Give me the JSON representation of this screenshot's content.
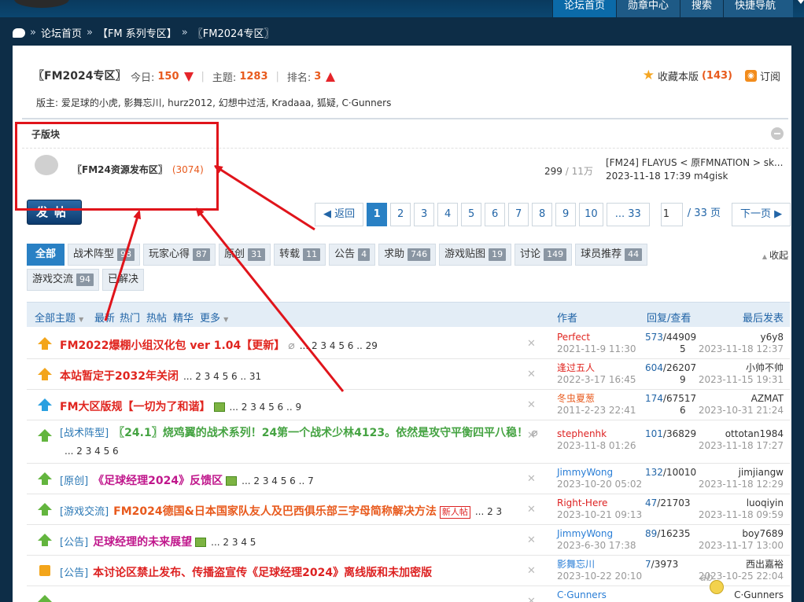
{
  "nav": {
    "items": [
      {
        "label": "论坛首页",
        "active": true
      },
      {
        "label": "勋章中心",
        "active": false
      },
      {
        "label": "搜索",
        "active": false
      },
      {
        "label": "快捷导航",
        "active": false
      }
    ]
  },
  "breadcrumb": {
    "items": [
      "论坛首页",
      "【FM 系列专区】",
      "〖FM2024专区〗"
    ],
    "sep": "»"
  },
  "forum": {
    "title": "〖FM2024专区〗",
    "today_label": "今日:",
    "today": "150",
    "topics_label": "主题:",
    "topics": "1283",
    "rank_label": "排名:",
    "rank": "3",
    "fav_label": "收藏本版",
    "fav_count": "(143)",
    "subscribe_label": "订阅",
    "moderators": "版主: 爱足球的小虎, 影舞忘川, hurz2012, 幻想中过活, Kradaaa, 狐疑, C·Gunners"
  },
  "subforums": {
    "heading": "子版块",
    "items": [
      {
        "name": "〖FM24资源发布区〗",
        "count": "(3074)",
        "stat": "299",
        "stat2": "11万",
        "stat_sep": "/",
        "last_title": "[FM24] FLAYUS < 原FMNATION > sk...",
        "last_info": "2023-11-18 17:39 m4gisk"
      }
    ]
  },
  "post_button": "发帖",
  "pager": {
    "back": "返回",
    "pages": [
      "1",
      "2",
      "3",
      "4",
      "5",
      "6",
      "7",
      "8",
      "9",
      "10",
      "... 33"
    ],
    "current": "1",
    "input_value": "1",
    "total": "/ 33 页",
    "next": "下一页"
  },
  "types": {
    "items": [
      {
        "label": "全部",
        "count": "",
        "active": true
      },
      {
        "label": "战术阵型",
        "count": "98"
      },
      {
        "label": "玩家心得",
        "count": "87"
      },
      {
        "label": "原创",
        "count": "31"
      },
      {
        "label": "转载",
        "count": "11"
      },
      {
        "label": "公告",
        "count": "4"
      },
      {
        "label": "求助",
        "count": "746"
      },
      {
        "label": "游戏贴图",
        "count": "19"
      },
      {
        "label": "讨论",
        "count": "149"
      },
      {
        "label": "球员推荐",
        "count": "44"
      },
      {
        "label": "游戏交流",
        "count": "94"
      },
      {
        "label": "已解决",
        "count": ""
      }
    ],
    "fold": "收起"
  },
  "table_head": {
    "all": "全部主题",
    "latest": "最新",
    "hot": "热门",
    "hotpost": "热帖",
    "digest": "精华",
    "more": "更多",
    "author": "作者",
    "reply_view": "回复/查看",
    "last_post": "最后发表"
  },
  "threads": [
    {
      "icon": "orange",
      "cat": "",
      "title": "FM2022爆棚小组汉化包 ver 1.04【更新】",
      "color": "red",
      "clip": true,
      "img": false,
      "newtag": false,
      "pages": "... 2 3 4 5 6 .. 29",
      "author": "Perfect",
      "author_color": "red",
      "date": "2021-11-9 11:30",
      "replies": "573",
      "views": "44909",
      "views2": "5",
      "last_user": "y6y8",
      "last_date": "2023-11-18 12:37"
    },
    {
      "icon": "orange",
      "cat": "",
      "title": "本站暂定于2032年关闭",
      "color": "red",
      "clip": false,
      "img": false,
      "newtag": false,
      "pages": "... 2 3 4 5 6 .. 31",
      "author": "逢过五人",
      "author_color": "red",
      "date": "2022-3-17 16:45",
      "replies": "604",
      "views": "26207",
      "views2": "9",
      "last_user": "小帅不帅",
      "last_date": "2023-11-15 19:31"
    },
    {
      "icon": "blue",
      "cat": "",
      "title": "FM大区版规【一切为了和谐】",
      "color": "red",
      "clip": false,
      "img": true,
      "newtag": false,
      "pages": "... 2 3 4 5 6 .. 9",
      "author": "冬虫夏葱",
      "author_color": "orange",
      "date": "2011-2-23 22:41",
      "replies": "174",
      "views": "67517",
      "views2": "6",
      "last_user": "AZMAT",
      "last_date": "2023-10-31 21:24"
    },
    {
      "icon": "green",
      "cat": "[战术阵型]",
      "title": "〖24.1〗烧鸡翼的战术系列！24第一个战术少林4123。依然是攻守平衡四平八稳！",
      "color": "green",
      "clip": true,
      "img": false,
      "newtag": false,
      "pages": "... 2 3 4 5 6",
      "author": "stephenhk",
      "author_color": "dark",
      "date": "2023-11-8 01:26",
      "replies": "101",
      "views": "36829",
      "views2": "",
      "last_user": "ottotan1984",
      "last_date": "2023-11-18 17:27",
      "tall": true
    },
    {
      "icon": "green",
      "cat": "[原创]",
      "title": "《足球经理2024》反馈区",
      "color": "purple",
      "clip": false,
      "img": true,
      "newtag": false,
      "pages": "... 2 3 4 5 6 .. 7",
      "author": "JimmyWong",
      "author_color": "blue",
      "date": "2023-10-20 05:02",
      "replies": "132",
      "views": "10010",
      "views2": "",
      "last_user": "jimjiangw",
      "last_date": "2023-11-18 12:29"
    },
    {
      "icon": "green",
      "cat": "[游戏交流]",
      "title": "FM2024德国&日本国家队友人及巴西俱乐部三字母简称解决方法",
      "color": "orange",
      "clip": false,
      "img": false,
      "newtag": true,
      "newtag_label": "新人帖",
      "pages": "... 2 3",
      "author": "Right-Here",
      "author_color": "dark",
      "date": "2023-10-21 09:13",
      "replies": "47",
      "views": "21703",
      "views2": "",
      "last_user": "luoqiyin",
      "last_date": "2023-11-18 09:59"
    },
    {
      "icon": "green",
      "cat": "[公告]",
      "title": "足球经理的未来展望",
      "color": "purple",
      "clip": false,
      "img": true,
      "newtag": false,
      "pages": "... 2 3 4 5",
      "author": "JimmyWong",
      "author_color": "blue",
      "date": "2023-6-30 17:38",
      "replies": "89",
      "views": "16235",
      "views2": "",
      "last_user": "boy7689",
      "last_date": "2023-11-17 13:00"
    },
    {
      "icon": "lock",
      "cat": "[公告]",
      "title": "本讨论区禁止发布、传播盗宣传《足球经理2024》离线版和未加密版",
      "color": "dark",
      "clip": false,
      "img": false,
      "newtag": false,
      "pages": "",
      "author": "影舞忘川",
      "author_color": "blue",
      "date": "2023-10-22 20:10",
      "replies": "7",
      "views": "3973",
      "views2": "",
      "last_user": "西出嘉裕",
      "last_date": "2023-10-25 22:04"
    },
    {
      "icon": "green",
      "cat": "",
      "title": "",
      "color": "dark",
      "clip": false,
      "img": false,
      "newtag": false,
      "pages": "",
      "author": "C·Gunners",
      "author_color": "blue",
      "date": "",
      "replies": "",
      "views": "",
      "views2": "",
      "last_user": "C·Gunners",
      "last_date": ""
    }
  ],
  "colors": {
    "accent": "#2980c4",
    "highlight_box": "#e0141b",
    "topbar": "#0d2d47"
  }
}
